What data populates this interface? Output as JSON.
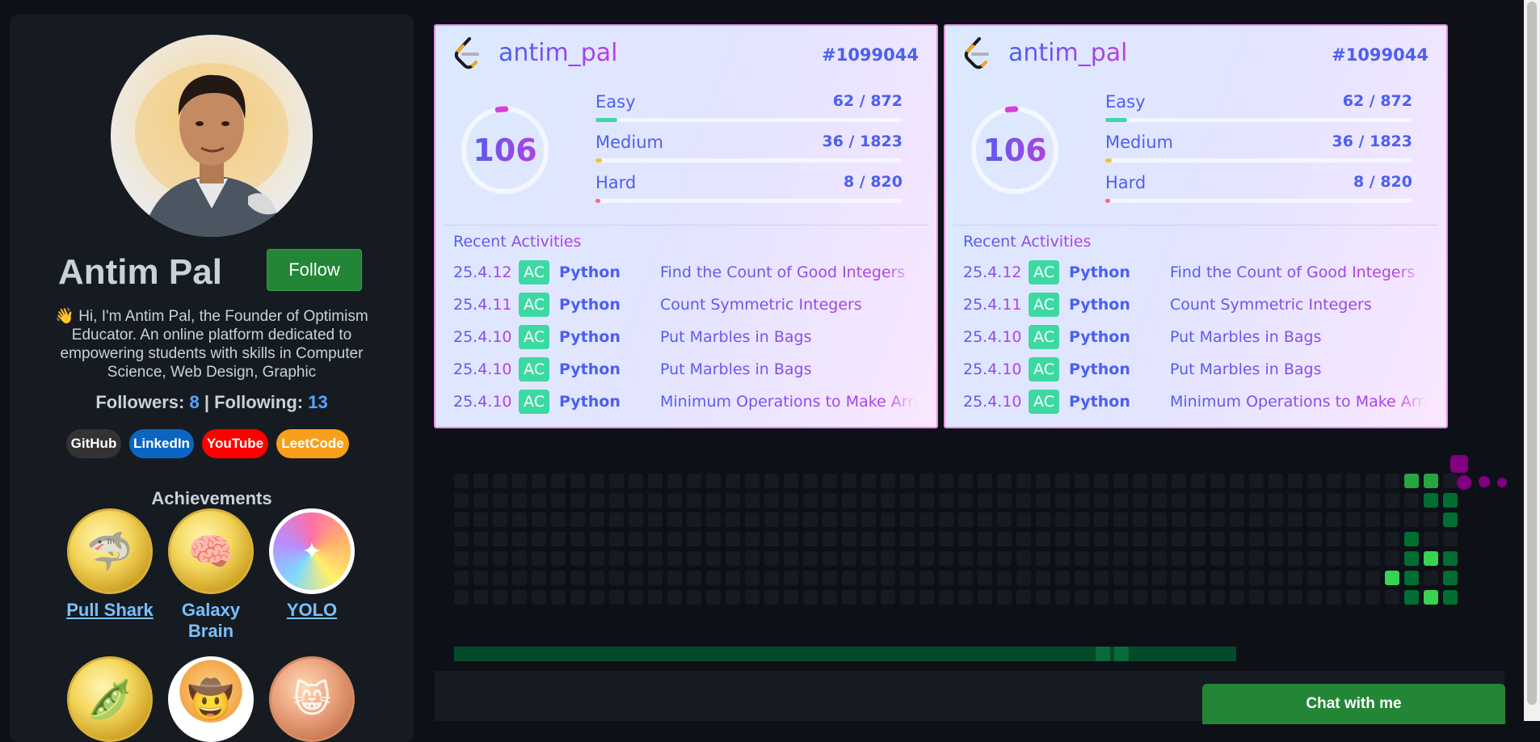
{
  "profile": {
    "name": "Antim Pal",
    "follow_label": "Follow",
    "bio": "👋 Hi, I'm Antim Pal, the Founder of Optimism Educator. An online platform dedicated to empowering students with skills in Computer Science, Web Design, Graphic",
    "followers_label": "Followers:",
    "followers": "8",
    "separator": "|",
    "following_label": "Following:",
    "following": "13"
  },
  "socials": [
    {
      "label": "GitHub",
      "color": "#333333"
    },
    {
      "label": "LinkedIn",
      "color": "#0a66c2"
    },
    {
      "label": "YouTube",
      "color": "#ff0000"
    },
    {
      "label": "LeetCode",
      "color": "#f89f1b"
    }
  ],
  "achievements": {
    "title": "Achievements",
    "items": [
      {
        "label": "Pull Shark",
        "icon": "shark-icon"
      },
      {
        "label": "Galaxy Brain",
        "icon": "brain-icon"
      },
      {
        "label": "YOLO",
        "icon": "yolo-icon"
      },
      {
        "label": "",
        "icon": "pea-pod-icon"
      },
      {
        "label": "",
        "icon": "cowboy-icon"
      },
      {
        "label": "",
        "icon": "cat-icon"
      }
    ]
  },
  "leetcode": {
    "username": "antim_pal",
    "rank": "#1099044",
    "solved": "106",
    "solved_fraction": 0.03,
    "difficulties": [
      {
        "label": "Easy",
        "count": "62 / 872",
        "fraction": 0.071,
        "color": "#3dd9a3"
      },
      {
        "label": "Medium",
        "count": "36 / 1823",
        "fraction": 0.02,
        "color": "#f7c324"
      },
      {
        "label": "Hard",
        "count": "8 / 820",
        "fraction": 0.01,
        "color": "#f06b88"
      }
    ],
    "recent_title": "Recent Activities",
    "activities": [
      {
        "date": "25.4.12",
        "status": "AC",
        "lang": "Python",
        "title": "Find the Count of Good Integers"
      },
      {
        "date": "25.4.11",
        "status": "AC",
        "lang": "Python",
        "title": "Count Symmetric Integers"
      },
      {
        "date": "25.4.10",
        "status": "AC",
        "lang": "Python",
        "title": "Put Marbles in Bags"
      },
      {
        "date": "25.4.10",
        "status": "AC",
        "lang": "Python",
        "title": "Put Marbles in Bags"
      },
      {
        "date": "25.4.10",
        "status": "AC",
        "lang": "Python",
        "title": "Minimum Operations to Make Array Values Equal to K"
      }
    ]
  },
  "colors": {
    "accent_blue": "#4b5ff1",
    "accent_purple": "#c13ce0",
    "graph_empty": "#161b22",
    "graph_l1": "#0e4429",
    "graph_l2": "#006d32",
    "graph_l3": "#26a641",
    "graph_l4": "#39d353",
    "snake": "#800080"
  },
  "chat": {
    "label": "Chat with me"
  }
}
